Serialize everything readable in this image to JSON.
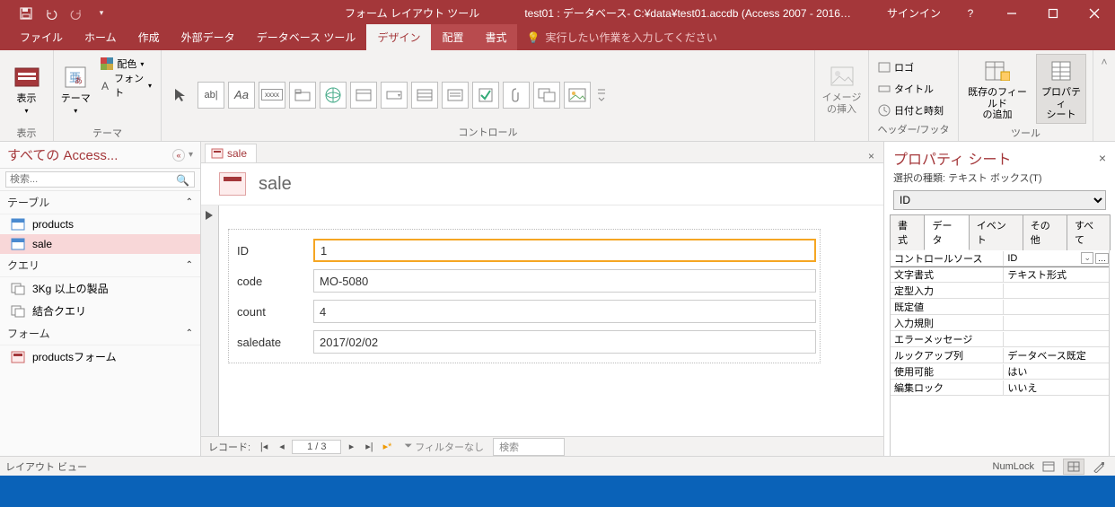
{
  "titlebar": {
    "context_tool": "フォーム レイアウト ツール",
    "app_title": "test01 : データベース- C:¥data¥test01.accdb (Access 2007 - 2016…",
    "signin": "サインイン"
  },
  "tabs": {
    "file": "ファイル",
    "home": "ホーム",
    "create": "作成",
    "external": "外部データ",
    "dbtools": "データベース ツール",
    "design": "デザイン",
    "arrange": "配置",
    "format": "書式",
    "tell_placeholder": "実行したい作業を入力してください"
  },
  "ribbon": {
    "group_view": "表示",
    "view_btn": "表示",
    "group_theme": "テーマ",
    "theme_btn": "テーマ",
    "colors_btn": "配色",
    "fonts_btn": "フォント",
    "group_controls": "コントロール",
    "insert_image_btn": "イメージ\nの挿入",
    "group_headerfooter": "ヘッダー/フッター",
    "logo_btn": "ロゴ",
    "title_btn": "タイトル",
    "datetime_btn": "日付と時刻",
    "group_tools": "ツール",
    "addfields_btn": "既存のフィールド\nの追加",
    "propsheet_btn": "プロパティ\nシート"
  },
  "nav": {
    "header": "すべての Access...",
    "search_placeholder": "検索...",
    "cat_tables": "テーブル",
    "cat_queries": "クエリ",
    "cat_forms": "フォーム",
    "items": {
      "products": "products",
      "sale": "sale",
      "q1": "3Kg 以上の製品",
      "q2": "結合クエリ",
      "f1": "productsフォーム"
    }
  },
  "doc": {
    "tab_label": "sale",
    "form_title": "sale",
    "fields": {
      "id_label": "ID",
      "id_val": "1",
      "code_label": "code",
      "code_val": "MO-5080",
      "count_label": "count",
      "count_val": "4",
      "saledate_label": "saledate",
      "saledate_val": "2017/02/02"
    },
    "recnav": {
      "label": "レコード:",
      "pos": "1 / 3",
      "filter": "フィルターなし",
      "search": "検索"
    }
  },
  "props": {
    "title": "プロパティ シート",
    "seltype": "選択の種類: テキスト ボックス(T)",
    "selected": "ID",
    "tabs": {
      "format": "書式",
      "data": "データ",
      "event": "イベント",
      "other": "その他",
      "all": "すべて"
    },
    "rows": [
      {
        "n": "コントロールソース",
        "v": "ID",
        "dd": true,
        "bld": true
      },
      {
        "n": "文字書式",
        "v": "テキスト形式"
      },
      {
        "n": "定型入力",
        "v": ""
      },
      {
        "n": "既定値",
        "v": ""
      },
      {
        "n": "入力規則",
        "v": ""
      },
      {
        "n": "エラーメッセージ",
        "v": ""
      },
      {
        "n": "ルックアップ列",
        "v": "データベース既定"
      },
      {
        "n": "使用可能",
        "v": "はい"
      },
      {
        "n": "編集ロック",
        "v": "いいえ"
      }
    ]
  },
  "status": {
    "left": "レイアウト ビュー",
    "numlock": "NumLock"
  }
}
